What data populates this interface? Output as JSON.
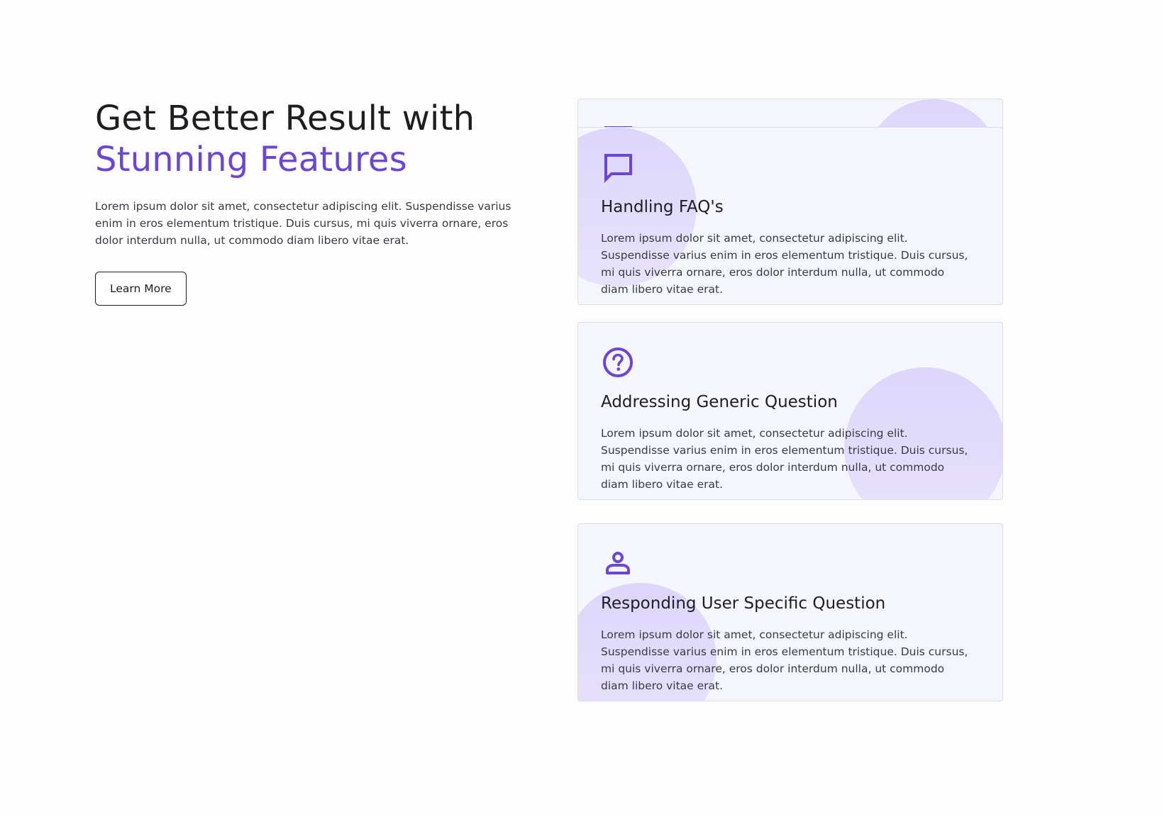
{
  "intro": {
    "title_line1": "Get Better Result with",
    "title_line2": "Stunning Features",
    "description": "Lorem ipsum dolor sit amet, consectetur adipiscing elit. Suspendisse varius enim in eros elementum tristique. Duis cursus, mi quis viverra ornare, eros dolor interdum nulla, ut commodo diam libero vitae erat.",
    "button_label": "Learn More"
  },
  "colors": {
    "accent": "#6b45d6",
    "card_bg": "#f4f6fb",
    "blob": "#ddd6fb"
  },
  "features": [
    {
      "icon": "chat-bubble-icon",
      "title": "Handling FAQ's",
      "description": "Lorem ipsum dolor sit amet, consectetur adipiscing elit. Suspendisse varius enim in eros elementum tristique. Duis cursus, mi quis viverra ornare, eros dolor interdum nulla, ut commodo diam libero vitae erat."
    },
    {
      "icon": "question-circle-icon",
      "title": "Addressing Generic Question",
      "description": "Lorem ipsum dolor sit amet, consectetur adipiscing elit. Suspendisse varius enim in eros elementum tristique. Duis cursus, mi quis viverra ornare, eros dolor interdum nulla, ut commodo diam libero vitae erat."
    },
    {
      "icon": "user-icon",
      "title": "Responding User Specific Question",
      "description": "Lorem ipsum dolor sit amet, consectetur adipiscing elit. Suspendisse varius enim in eros elementum tristique. Duis cursus, mi quis viverra ornare, eros dolor interdum nulla, ut commodo diam libero vitae erat."
    }
  ]
}
